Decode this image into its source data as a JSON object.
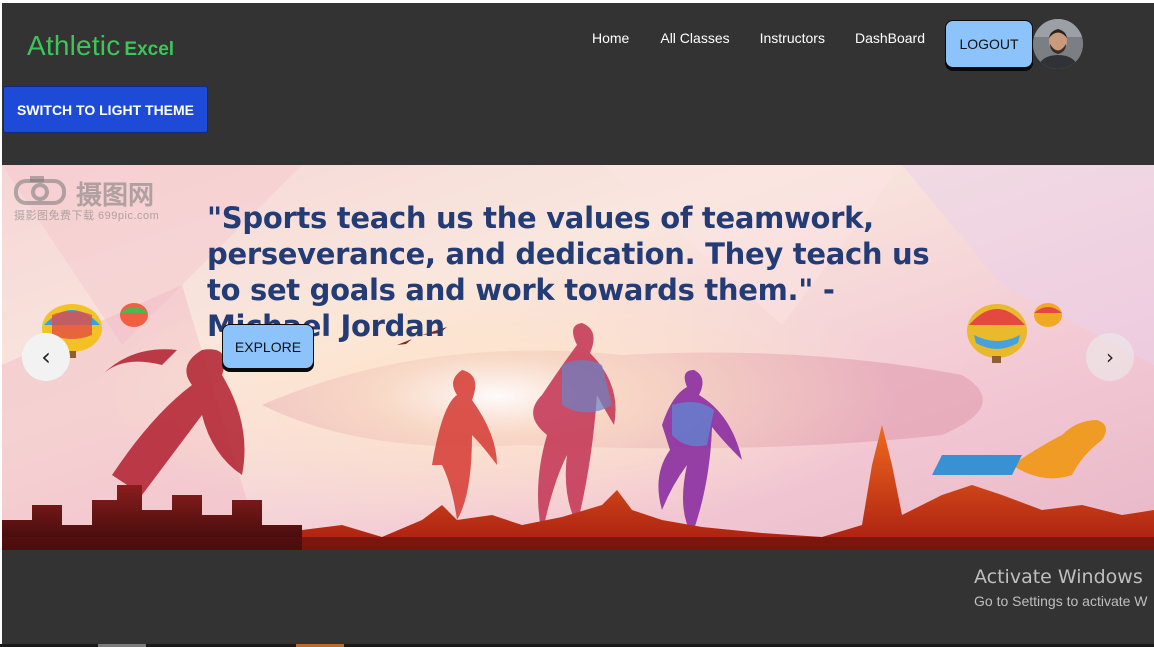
{
  "brand": {
    "part1": "Athletic",
    "part2": "Excel"
  },
  "nav": {
    "items": [
      "Home",
      "All Classes",
      "Instructors",
      "DashBoard"
    ]
  },
  "header": {
    "logout_label": "LOGOUT"
  },
  "theme": {
    "toggle_label": "SWITCH TO LIGHT THEME"
  },
  "carousel": {
    "quote": "\"Sports teach us the values of teamwork, perseverance, and dedication. They teach us to set goals and work towards them.\" - Michael Jordan",
    "explore_label": "EXPLORE",
    "prev_glyph": "‹",
    "next_glyph": "›",
    "watermark_main": "摄图网",
    "watermark_sub": "摄影图免费下载 699pic.com"
  },
  "system": {
    "activate_title": "Activate Windows",
    "activate_sub": "Go to Settings to activate W"
  },
  "colors": {
    "brand": "#3ec45a",
    "background": "#333333",
    "primary_button": "#1d4bd8",
    "light_button": "#8cc3fb",
    "quote_text": "#243c75"
  },
  "icons": [
    "user-avatar",
    "chevron-left-icon",
    "chevron-right-icon",
    "camera-icon"
  ]
}
